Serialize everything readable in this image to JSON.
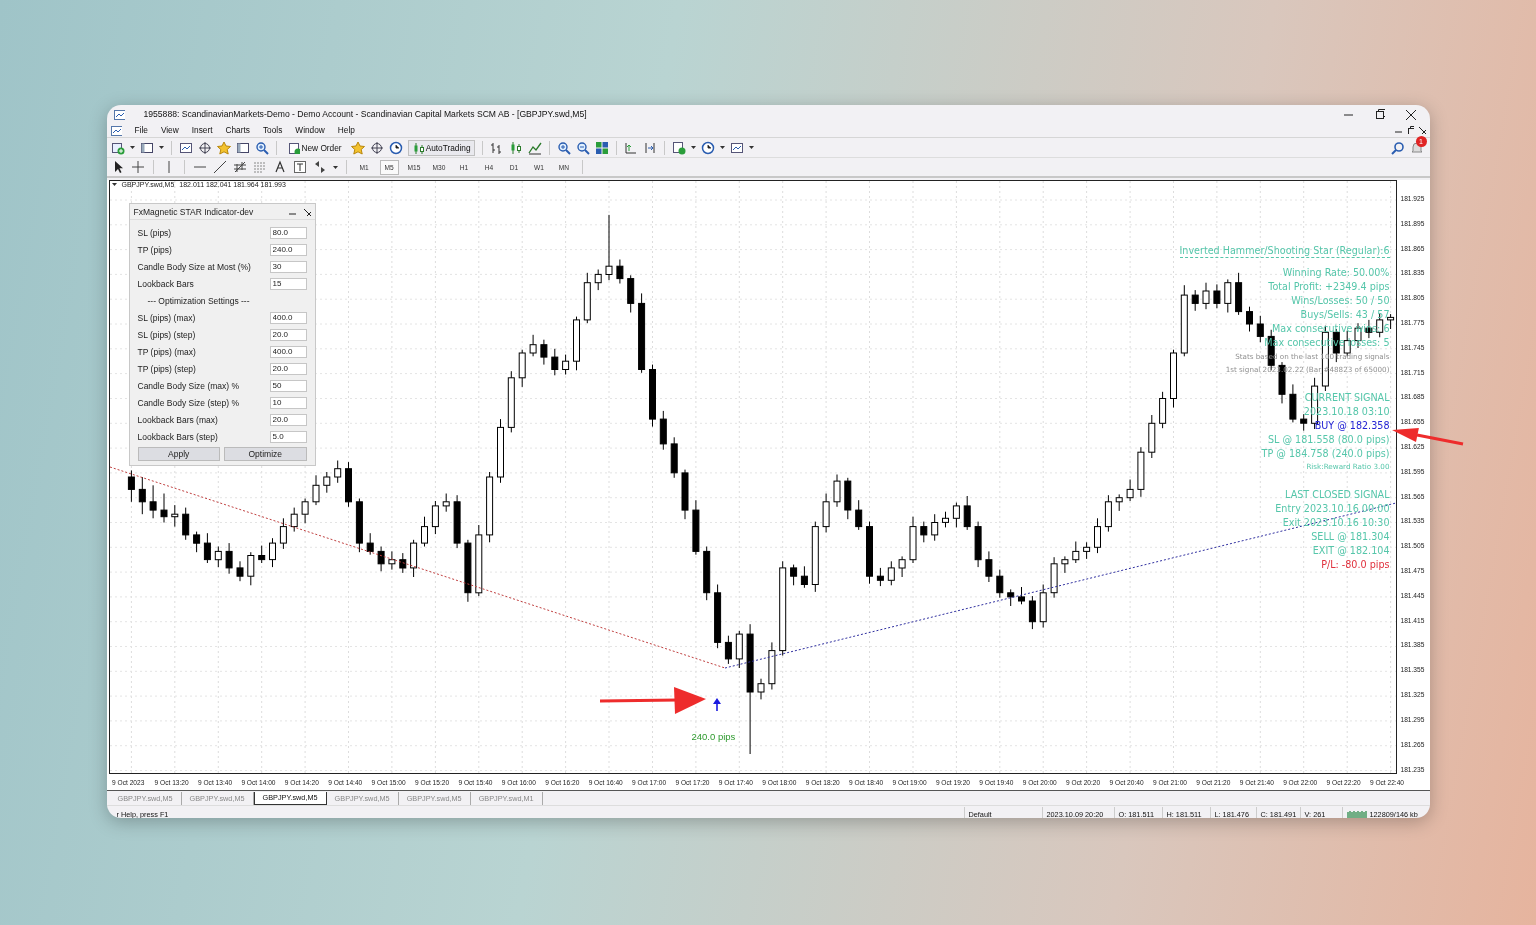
{
  "window": {
    "title": "1955888: ScandinavianMarkets-Demo - Demo Account - Scandinavian Capital Markets SCM AB - [GBPJPY.swd,M5]"
  },
  "menu": [
    "File",
    "View",
    "Insert",
    "Charts",
    "Tools",
    "Window",
    "Help"
  ],
  "toolbar": {
    "new_order": "New Order",
    "auto_trading": "AutoTrading",
    "notifications": "1"
  },
  "timeframes": [
    {
      "label": "M1",
      "selected": false
    },
    {
      "label": "M5",
      "selected": true
    },
    {
      "label": "M15",
      "selected": false
    },
    {
      "label": "M30",
      "selected": false
    },
    {
      "label": "H1",
      "selected": false
    },
    {
      "label": "H4",
      "selected": false
    },
    {
      "label": "D1",
      "selected": false
    },
    {
      "label": "W1",
      "selected": false
    },
    {
      "label": "MN",
      "selected": false
    }
  ],
  "chart": {
    "symbol": "GBPJPY.swd,M5",
    "prices": "182.011 182.041 181.964 181.993",
    "trade_marker": "240.0 pips",
    "chart_data": {
      "type": "candlestick",
      "categories": [
        "9 Oct 2023",
        null,
        null,
        null,
        "9 Oct 13:20",
        null,
        null,
        null,
        "9 Oct 13:40",
        null,
        null,
        null,
        "9 Oct 14:00",
        null,
        null,
        null,
        "9 Oct 14:20",
        null,
        null,
        null,
        "9 Oct 14:40",
        null,
        null,
        null,
        "9 Oct 15:00",
        null,
        null,
        null,
        "9 Oct 15:20",
        null,
        null,
        null,
        "9 Oct 15:40",
        null,
        null,
        null,
        "9 Oct 16:00",
        null,
        null,
        null,
        "9 Oct 16:20",
        null,
        null,
        null,
        "9 Oct 16:40",
        null,
        null,
        null,
        "9 Oct 17:00",
        null,
        null,
        null,
        "9 Oct 17:20",
        null,
        null,
        null,
        "9 Oct 17:40",
        null,
        null,
        null,
        "9 Oct 18:00",
        null,
        null,
        null,
        "9 Oct 18:20",
        null,
        null,
        null,
        "9 Oct 18:40",
        null,
        null,
        null,
        "9 Oct 19:00",
        null,
        null,
        null,
        "9 Oct 19:20",
        null,
        null,
        null,
        "9 Oct 19:40",
        null,
        null,
        null,
        "9 Oct 20:00",
        null,
        null,
        null,
        "9 Oct 20:20",
        null,
        null,
        null,
        "9 Oct 20:40",
        null,
        null,
        null,
        "9 Oct 21:00",
        null,
        null,
        null,
        "9 Oct 21:20",
        null,
        null,
        null,
        "9 Oct 21:40",
        null,
        null,
        null,
        "9 Oct 22:00",
        null,
        null,
        null,
        "9 Oct 22:20",
        null,
        null,
        null,
        "9 Oct 22:40"
      ],
      "ohlc": [
        [
          181.59,
          181.598,
          181.56,
          181.575
        ],
        [
          181.575,
          181.59,
          181.545,
          181.56
        ],
        [
          181.56,
          181.58,
          181.54,
          181.55
        ],
        [
          181.55,
          181.57,
          181.535,
          181.542
        ],
        [
          181.542,
          181.556,
          181.53,
          181.545
        ],
        [
          181.545,
          181.553,
          181.514,
          181.52
        ],
        [
          181.52,
          181.524,
          181.499,
          181.51
        ],
        [
          181.51,
          181.522,
          181.486,
          181.49
        ],
        [
          181.49,
          181.506,
          181.481,
          181.5
        ],
        [
          181.5,
          181.51,
          181.473,
          181.48
        ],
        [
          181.48,
          181.488,
          181.464,
          181.47
        ],
        [
          181.47,
          181.499,
          181.459,
          181.495
        ],
        [
          181.495,
          181.507,
          181.486,
          181.49
        ],
        [
          181.49,
          181.516,
          181.481,
          181.51
        ],
        [
          181.51,
          181.54,
          181.503,
          181.53
        ],
        [
          181.53,
          181.553,
          181.524,
          181.545
        ],
        [
          181.545,
          181.564,
          181.534,
          181.56
        ],
        [
          181.56,
          181.592,
          181.556,
          181.58
        ],
        [
          181.58,
          181.596,
          181.571,
          181.59
        ],
        [
          181.59,
          181.61,
          181.583,
          181.6
        ],
        [
          181.6,
          181.608,
          181.554,
          181.56
        ],
        [
          181.56,
          181.564,
          181.499,
          181.51
        ],
        [
          181.51,
          181.522,
          181.496,
          181.5
        ],
        [
          181.5,
          181.506,
          181.476,
          181.485
        ],
        [
          181.485,
          181.5,
          181.478,
          181.49
        ],
        [
          181.49,
          181.498,
          181.474,
          181.48
        ],
        [
          181.48,
          181.514,
          181.469,
          181.51
        ],
        [
          181.51,
          181.542,
          181.506,
          181.53
        ],
        [
          181.53,
          181.561,
          181.521,
          181.555
        ],
        [
          181.555,
          181.57,
          181.548,
          181.56
        ],
        [
          181.56,
          181.568,
          181.504,
          181.51
        ],
        [
          181.51,
          181.514,
          181.439,
          181.45
        ],
        [
          181.45,
          181.532,
          181.446,
          181.52
        ],
        [
          181.52,
          181.596,
          181.511,
          181.59
        ],
        [
          181.59,
          181.66,
          181.583,
          181.65
        ],
        [
          181.65,
          181.718,
          181.644,
          181.71
        ],
        [
          181.71,
          181.744,
          181.699,
          181.74
        ],
        [
          181.74,
          181.762,
          181.736,
          181.75
        ],
        [
          181.75,
          181.756,
          181.726,
          181.735
        ],
        [
          181.735,
          181.745,
          181.713,
          181.72
        ],
        [
          181.72,
          181.738,
          181.714,
          181.73
        ],
        [
          181.73,
          181.784,
          181.719,
          181.78
        ],
        [
          181.78,
          181.837,
          181.776,
          181.825
        ],
        [
          181.825,
          181.841,
          181.816,
          181.835
        ],
        [
          181.835,
          181.907,
          181.828,
          181.845
        ],
        [
          181.845,
          181.853,
          181.824,
          181.83
        ],
        [
          181.83,
          181.834,
          181.789,
          181.8
        ],
        [
          181.8,
          181.812,
          181.716,
          181.72
        ],
        [
          181.72,
          181.726,
          181.651,
          181.66
        ],
        [
          181.66,
          181.67,
          181.623,
          181.63
        ],
        [
          181.63,
          181.638,
          181.589,
          181.595
        ],
        [
          181.595,
          181.599,
          181.539,
          181.55
        ],
        [
          181.55,
          181.562,
          181.496,
          181.5
        ],
        [
          181.5,
          181.506,
          181.441,
          181.45
        ],
        [
          181.45,
          181.46,
          181.383,
          181.39
        ],
        [
          181.39,
          181.398,
          181.364,
          181.37
        ],
        [
          181.37,
          181.404,
          181.359,
          181.4
        ],
        [
          181.4,
          181.412,
          181.255,
          181.33
        ],
        [
          181.33,
          181.346,
          181.321,
          181.34
        ],
        [
          181.34,
          181.39,
          181.333,
          181.38
        ],
        [
          181.38,
          181.488,
          181.374,
          181.48
        ],
        [
          181.48,
          181.484,
          181.459,
          181.47
        ],
        [
          181.47,
          181.482,
          181.456,
          181.46
        ],
        [
          181.46,
          181.536,
          181.451,
          181.53
        ],
        [
          181.53,
          181.57,
          181.523,
          181.56
        ],
        [
          181.56,
          181.593,
          181.554,
          181.585
        ],
        [
          181.585,
          181.589,
          181.539,
          181.55
        ],
        [
          181.55,
          181.562,
          181.526,
          181.53
        ],
        [
          181.53,
          181.536,
          181.461,
          181.47
        ],
        [
          181.47,
          181.48,
          181.458,
          181.465
        ],
        [
          181.465,
          181.488,
          181.459,
          181.48
        ],
        [
          181.48,
          181.494,
          181.469,
          181.49
        ],
        [
          181.49,
          181.542,
          181.486,
          181.53
        ],
        [
          181.53,
          181.536,
          181.511,
          181.52
        ],
        [
          181.52,
          181.545,
          181.513,
          181.535
        ],
        [
          181.535,
          181.548,
          181.529,
          181.54
        ],
        [
          181.54,
          181.559,
          181.529,
          181.555
        ],
        [
          181.555,
          181.567,
          181.526,
          181.53
        ],
        [
          181.53,
          181.536,
          181.481,
          181.49
        ],
        [
          181.49,
          181.5,
          181.463,
          181.47
        ],
        [
          181.47,
          181.478,
          181.444,
          181.45
        ],
        [
          181.45,
          181.454,
          181.434,
          181.445
        ],
        [
          181.445,
          181.457,
          181.436,
          181.44
        ],
        [
          181.44,
          181.446,
          181.406,
          181.415
        ],
        [
          181.415,
          181.46,
          181.408,
          181.45
        ],
        [
          181.45,
          181.493,
          181.444,
          181.485
        ],
        [
          181.485,
          181.494,
          181.474,
          181.49
        ],
        [
          181.49,
          181.512,
          181.486,
          181.5
        ],
        [
          181.5,
          181.511,
          181.491,
          181.505
        ],
        [
          181.505,
          181.54,
          181.498,
          181.53
        ],
        [
          181.53,
          181.568,
          181.524,
          181.56
        ],
        [
          181.56,
          181.569,
          181.549,
          181.565
        ],
        [
          181.565,
          181.587,
          181.561,
          181.575
        ],
        [
          181.575,
          181.626,
          181.566,
          181.62
        ],
        [
          181.62,
          181.665,
          181.613,
          181.655
        ],
        [
          181.655,
          181.693,
          181.649,
          181.685
        ],
        [
          181.685,
          181.744,
          181.674,
          181.74
        ],
        [
          181.74,
          181.822,
          181.736,
          181.81
        ],
        [
          181.81,
          181.816,
          181.791,
          181.8
        ],
        [
          181.8,
          181.825,
          181.793,
          181.815
        ],
        [
          181.815,
          181.823,
          181.794,
          181.8
        ],
        [
          181.8,
          181.829,
          181.789,
          181.825
        ],
        [
          181.825,
          181.837,
          181.786,
          181.79
        ],
        [
          181.79,
          181.796,
          181.766,
          181.775
        ],
        [
          181.775,
          181.785,
          181.753,
          181.76
        ],
        [
          181.76,
          181.768,
          181.719,
          181.725
        ],
        [
          181.725,
          181.729,
          181.679,
          181.69
        ],
        [
          181.69,
          181.702,
          181.656,
          181.66
        ],
        [
          181.66,
          181.666,
          181.646,
          181.655
        ],
        [
          181.655,
          181.71,
          181.648,
          181.7
        ],
        [
          181.7,
          181.773,
          181.694,
          181.765
        ],
        [
          181.765,
          181.769,
          181.729,
          181.74
        ],
        [
          181.74,
          181.767,
          181.736,
          181.755
        ],
        [
          181.755,
          181.776,
          181.746,
          181.77
        ],
        [
          181.77,
          181.78,
          181.758,
          181.765
        ],
        [
          181.765,
          181.788,
          181.759,
          181.78
        ],
        [
          181.78,
          181.787,
          181.769,
          181.783
        ]
      ],
      "ylim": [
        181.232,
        181.948
      ],
      "grid": true,
      "yticks": [
        181.925,
        181.895,
        181.865,
        181.835,
        181.805,
        181.775,
        181.745,
        181.715,
        181.685,
        181.655,
        181.625,
        181.595,
        181.565,
        181.535,
        181.505,
        181.475,
        181.445,
        181.415,
        181.385,
        181.355,
        181.325,
        181.295,
        181.265,
        181.235
      ]
    }
  },
  "indicator_panel": {
    "title": "FxMagnetic STAR Indicator-dev",
    "rows": [
      {
        "kind": "field",
        "label": "SL (pips)",
        "value": "80.0"
      },
      {
        "kind": "field",
        "label": "TP (pips)",
        "value": "240.0"
      },
      {
        "kind": "field",
        "label": "Candle Body Size at Most (%)",
        "value": "30"
      },
      {
        "kind": "field",
        "label": "Lookback Bars",
        "value": "15"
      },
      {
        "kind": "heading",
        "label": "--- Optimization Settings ---"
      },
      {
        "kind": "field",
        "label": "SL (pips) (max)",
        "value": "400.0"
      },
      {
        "kind": "field",
        "label": "SL (pips) (step)",
        "value": "20.0"
      },
      {
        "kind": "field",
        "label": "TP (pips) (max)",
        "value": "400.0"
      },
      {
        "kind": "field",
        "label": "TP (pips) (step)",
        "value": "20.0"
      },
      {
        "kind": "field",
        "label": "Candle Body Size (max) %",
        "value": "50"
      },
      {
        "kind": "field",
        "label": "Candle Body Size (step) %",
        "value": "10"
      },
      {
        "kind": "field",
        "label": "Lookback Bars (max)",
        "value": "20.0"
      },
      {
        "kind": "field",
        "label": "Lookback Bars (step)",
        "value": "5.0"
      }
    ],
    "buttons": [
      "Apply",
      "Optimize"
    ]
  },
  "overlay": {
    "title": "Inverted Hammer/Shooting Star (Regular):6",
    "stats": [
      {
        "kind": "line",
        "text": "Winning Rate: 50.00%"
      },
      {
        "kind": "line",
        "text": "Total Profit: +2349.4 pips"
      },
      {
        "kind": "line",
        "text": "Wins/Losses: 50 / 50"
      },
      {
        "kind": "line",
        "text": "Buys/Sells: 43 / 57"
      },
      {
        "kind": "line",
        "text": "Max consecutive wins: 6"
      },
      {
        "kind": "line",
        "text": "Max consecutive losses: 5"
      },
      {
        "kind": "note",
        "text": "Stats based on the last 100 trading signals"
      },
      {
        "kind": "note",
        "text": "1st signal 2023.02.22 (Bar #48823 of 65000)"
      }
    ],
    "current_signal": [
      {
        "kind": "line",
        "text": "CURRENT SIGNAL"
      },
      {
        "kind": "line",
        "text": "2023.10.18 03:10"
      },
      {
        "kind": "buy",
        "text": "BUY @ 182.358"
      },
      {
        "kind": "line",
        "text": "SL @ 181.558 (80.0 pips)"
      },
      {
        "kind": "line",
        "text": "TP @ 184.758 (240.0 pips)"
      },
      {
        "kind": "small",
        "text": "Risk:Reward Ratio 3.00"
      }
    ],
    "last_closed_signal": [
      {
        "kind": "line",
        "text": "LAST CLOSED SIGNAL"
      },
      {
        "kind": "line",
        "text": "Entry 2023.10.16 00:00"
      },
      {
        "kind": "line",
        "text": "Exit 2023.10.16 10:30"
      },
      {
        "kind": "line",
        "text": "SELL @ 181.304"
      },
      {
        "kind": "line",
        "text": "EXIT @ 182.104"
      },
      {
        "kind": "loss",
        "text": "P/L: -80.0 pips"
      }
    ]
  },
  "chart_tabs": [
    {
      "label": "GBPJPY.swd,M5",
      "selected": false
    },
    {
      "label": "GBPJPY.swd,M5",
      "selected": false
    },
    {
      "label": "GBPJPY.swd,M5",
      "selected": true
    },
    {
      "label": "GBPJPY.swd,M5",
      "selected": false
    },
    {
      "label": "GBPJPY.swd,M5",
      "selected": false
    },
    {
      "label": "GBPJPY.swd,M1",
      "selected": false
    }
  ],
  "status_bar": {
    "help": "r Help, press F1",
    "profile": "Default",
    "time": "2023.10.09 20:20",
    "open": "O: 181.511",
    "high": "H: 181.511",
    "low": "L: 181.476",
    "close": "C: 181.491",
    "volume": "V: 261",
    "traffic": "122809/146 kb"
  }
}
